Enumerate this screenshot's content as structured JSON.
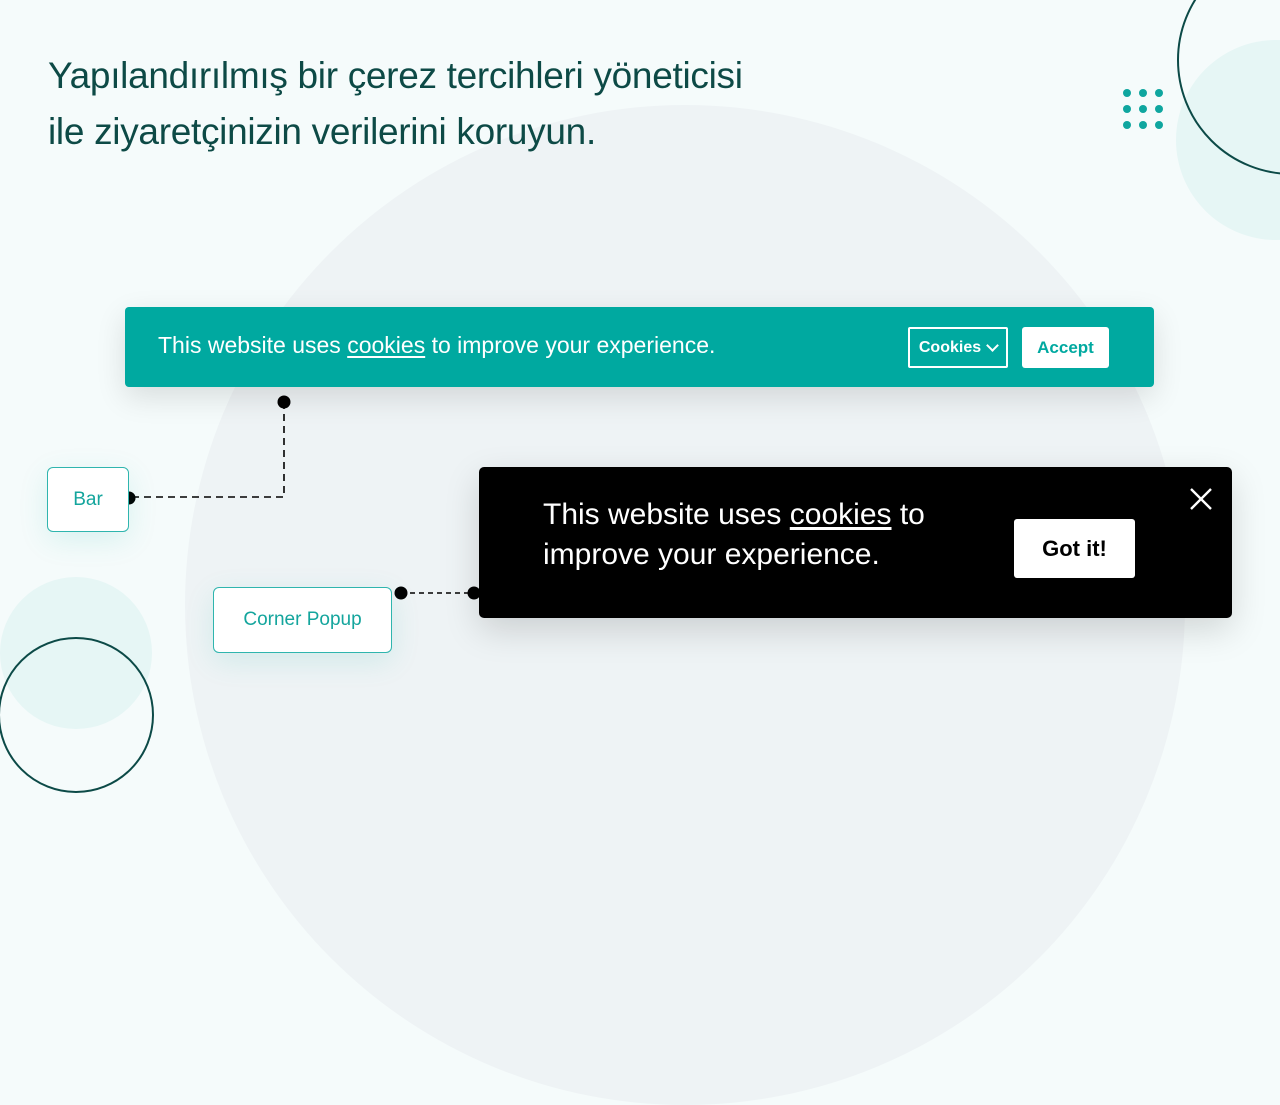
{
  "headline": {
    "line1": "Yapılandırılmış bir çerez tercihleri yöneticisi",
    "line2": "ile ziyaretçinizin verilerini koruyun."
  },
  "bar_banner": {
    "text_before": "This website uses ",
    "link": "cookies",
    "text_after": " to improve your experience.",
    "cookies_button": "Cookies",
    "accept_button": "Accept",
    "background_color": "#00a9a0"
  },
  "labels": {
    "bar": "Bar",
    "corner_popup": "Corner Popup"
  },
  "corner_popup": {
    "text_before": "This website uses ",
    "link": "cookies",
    "text_after": " to improve your experience.",
    "button": "Got it!",
    "close_icon": "close-icon",
    "background_color": "#000000"
  },
  "colors": {
    "accent": "#00a9a0",
    "headline": "#0d4a46"
  }
}
